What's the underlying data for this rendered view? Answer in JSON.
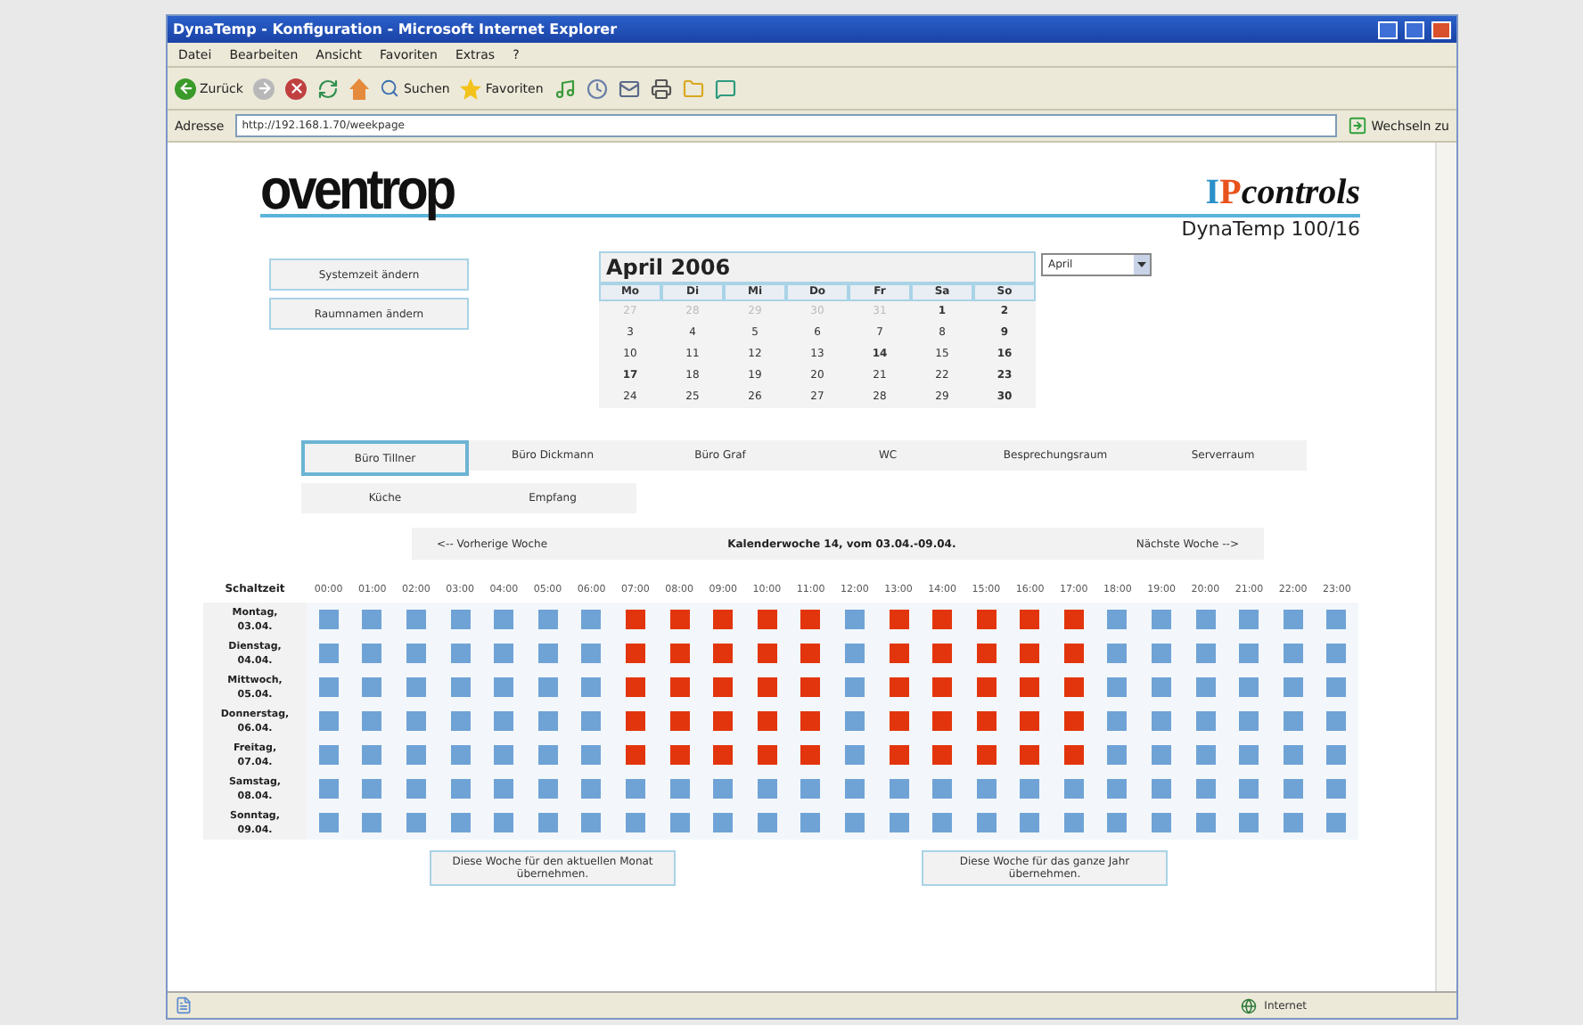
{
  "window": {
    "title": "DynaTemp - Konfiguration - Microsoft Internet Explorer"
  },
  "menu": [
    "Datei",
    "Bearbeiten",
    "Ansicht",
    "Favoriten",
    "Extras",
    "?"
  ],
  "toolbar": {
    "back": "Zurück",
    "search": "Suchen",
    "favorites": "Favoriten"
  },
  "address": {
    "label": "Adresse",
    "url": "http://192.168.1.70/weekpage",
    "go": "Wechseln zu"
  },
  "header": {
    "logo": "oventrop",
    "brand_first": "I",
    "brand_second": "P",
    "brand_rest": "controls",
    "product": "DynaTemp 100/16"
  },
  "side_buttons": [
    "Systemzeit ändern",
    "Raumnamen ändern"
  ],
  "calendar": {
    "title": "April 2006",
    "month_select": "April",
    "weekdays": [
      "Mo",
      "Di",
      "Mi",
      "Do",
      "Fr",
      "Sa",
      "So"
    ],
    "weeks": [
      [
        {
          "day": "27",
          "muted": true,
          "bold": false
        },
        {
          "day": "28",
          "muted": true,
          "bold": false
        },
        {
          "day": "29",
          "muted": true,
          "bold": false
        },
        {
          "day": "30",
          "muted": true,
          "bold": false
        },
        {
          "day": "31",
          "muted": true,
          "bold": false
        },
        {
          "day": "1",
          "muted": false,
          "bold": true
        },
        {
          "day": "2",
          "muted": false,
          "bold": true
        }
      ],
      [
        {
          "day": "3",
          "muted": false,
          "bold": false
        },
        {
          "day": "4",
          "muted": false,
          "bold": false
        },
        {
          "day": "5",
          "muted": false,
          "bold": false
        },
        {
          "day": "6",
          "muted": false,
          "bold": false
        },
        {
          "day": "7",
          "muted": false,
          "bold": false
        },
        {
          "day": "8",
          "muted": false,
          "bold": false
        },
        {
          "day": "9",
          "muted": false,
          "bold": true
        }
      ],
      [
        {
          "day": "10",
          "muted": false,
          "bold": false
        },
        {
          "day": "11",
          "muted": false,
          "bold": false
        },
        {
          "day": "12",
          "muted": false,
          "bold": false
        },
        {
          "day": "13",
          "muted": false,
          "bold": false
        },
        {
          "day": "14",
          "muted": false,
          "bold": true
        },
        {
          "day": "15",
          "muted": false,
          "bold": false
        },
        {
          "day": "16",
          "muted": false,
          "bold": true
        }
      ],
      [
        {
          "day": "17",
          "muted": false,
          "bold": true
        },
        {
          "day": "18",
          "muted": false,
          "bold": false
        },
        {
          "day": "19",
          "muted": false,
          "bold": false
        },
        {
          "day": "20",
          "muted": false,
          "bold": false
        },
        {
          "day": "21",
          "muted": false,
          "bold": false
        },
        {
          "day": "22",
          "muted": false,
          "bold": false
        },
        {
          "day": "23",
          "muted": false,
          "bold": true
        }
      ],
      [
        {
          "day": "24",
          "muted": false,
          "bold": false
        },
        {
          "day": "25",
          "muted": false,
          "bold": false
        },
        {
          "day": "26",
          "muted": false,
          "bold": false
        },
        {
          "day": "27",
          "muted": false,
          "bold": false
        },
        {
          "day": "28",
          "muted": false,
          "bold": false
        },
        {
          "day": "29",
          "muted": false,
          "bold": false
        },
        {
          "day": "30",
          "muted": false,
          "bold": true
        }
      ]
    ]
  },
  "rooms": [
    {
      "label": "Büro Tillner",
      "selected": true
    },
    {
      "label": "Büro Dickmann",
      "selected": false
    },
    {
      "label": "Büro Graf",
      "selected": false
    },
    {
      "label": "WC",
      "selected": false
    },
    {
      "label": "Besprechungsraum",
      "selected": false
    },
    {
      "label": "Serverraum",
      "selected": false
    },
    {
      "label": "Küche",
      "selected": false
    },
    {
      "label": "Empfang",
      "selected": false
    }
  ],
  "week_nav": {
    "previous": "<-- Vorherige Woche",
    "current": "Kalenderwoche 14, vom 03.04.-09.04.",
    "next": "Nächste Woche -->"
  },
  "schedule": {
    "corner": "Schaltzeit",
    "hours": [
      "00:00",
      "01:00",
      "02:00",
      "03:00",
      "04:00",
      "05:00",
      "06:00",
      "07:00",
      "08:00",
      "09:00",
      "10:00",
      "11:00",
      "12:00",
      "13:00",
      "14:00",
      "15:00",
      "16:00",
      "17:00",
      "18:00",
      "19:00",
      "20:00",
      "21:00",
      "22:00",
      "23:00"
    ],
    "rows": [
      {
        "day": "Montag,",
        "date": "03.04.",
        "slots": [
          false,
          false,
          false,
          false,
          false,
          false,
          false,
          true,
          true,
          true,
          true,
          true,
          false,
          true,
          true,
          true,
          true,
          true,
          false,
          false,
          false,
          false,
          false,
          false
        ]
      },
      {
        "day": "Dienstag,",
        "date": "04.04.",
        "slots": [
          false,
          false,
          false,
          false,
          false,
          false,
          false,
          true,
          true,
          true,
          true,
          true,
          false,
          true,
          true,
          true,
          true,
          true,
          false,
          false,
          false,
          false,
          false,
          false
        ]
      },
      {
        "day": "Mittwoch,",
        "date": "05.04.",
        "slots": [
          false,
          false,
          false,
          false,
          false,
          false,
          false,
          true,
          true,
          true,
          true,
          true,
          false,
          true,
          true,
          true,
          true,
          true,
          false,
          false,
          false,
          false,
          false,
          false
        ]
      },
      {
        "day": "Donnerstag,",
        "date": "06.04.",
        "slots": [
          false,
          false,
          false,
          false,
          false,
          false,
          false,
          true,
          true,
          true,
          true,
          true,
          false,
          true,
          true,
          true,
          true,
          true,
          false,
          false,
          false,
          false,
          false,
          false
        ]
      },
      {
        "day": "Freitag,",
        "date": "07.04.",
        "slots": [
          false,
          false,
          false,
          false,
          false,
          false,
          false,
          true,
          true,
          true,
          true,
          true,
          false,
          true,
          true,
          true,
          true,
          true,
          false,
          false,
          false,
          false,
          false,
          false
        ]
      },
      {
        "day": "Samstag,",
        "date": "08.04.",
        "slots": [
          false,
          false,
          false,
          false,
          false,
          false,
          false,
          false,
          false,
          false,
          false,
          false,
          false,
          false,
          false,
          false,
          false,
          false,
          false,
          false,
          false,
          false,
          false,
          false
        ]
      },
      {
        "day": "Sonntag,",
        "date": "09.04.",
        "slots": [
          false,
          false,
          false,
          false,
          false,
          false,
          false,
          false,
          false,
          false,
          false,
          false,
          false,
          false,
          false,
          false,
          false,
          false,
          false,
          false,
          false,
          false,
          false,
          false
        ]
      }
    ]
  },
  "copy_buttons": [
    "Diese Woche für den aktuellen Monat übernehmen.",
    "Diese Woche für das ganze Jahr übernehmen."
  ],
  "status_bar": {
    "zone": "Internet"
  }
}
